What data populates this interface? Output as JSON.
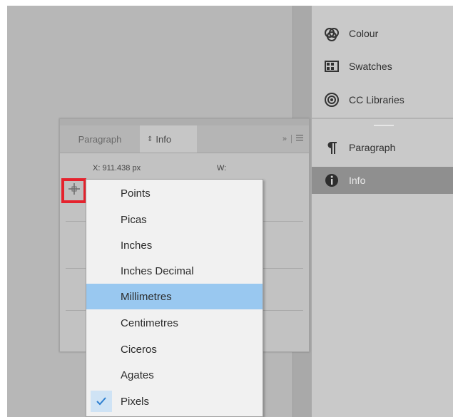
{
  "right_panel": {
    "items": [
      {
        "label": "Colour",
        "icon": "colour-icon"
      },
      {
        "label": "Swatches",
        "icon": "swatches-icon"
      },
      {
        "label": "CC Libraries",
        "icon": "cc-libraries-icon"
      },
      {
        "label": "Paragraph",
        "icon": "pilcrow-icon"
      },
      {
        "label": "Info",
        "icon": "info-icon",
        "active": true
      }
    ]
  },
  "info_panel": {
    "tabs": [
      {
        "label": "Paragraph"
      },
      {
        "label": "Info",
        "prefix": "⇕",
        "active": true
      }
    ],
    "expand_label": "»",
    "x_readout": "X: 911.438 px",
    "w_label": "W:"
  },
  "units_menu": {
    "items": [
      {
        "label": "Points"
      },
      {
        "label": "Picas"
      },
      {
        "label": "Inches"
      },
      {
        "label": "Inches Decimal"
      },
      {
        "label": "Millimetres",
        "highlighted": true
      },
      {
        "label": "Centimetres"
      },
      {
        "label": "Ciceros"
      },
      {
        "label": "Agates"
      },
      {
        "label": "Pixels",
        "checked": true
      }
    ]
  },
  "colors": {
    "highlight_border": "#e5222d",
    "menu_highlight": "#99c8f0",
    "check_color": "#2f7fd0"
  }
}
